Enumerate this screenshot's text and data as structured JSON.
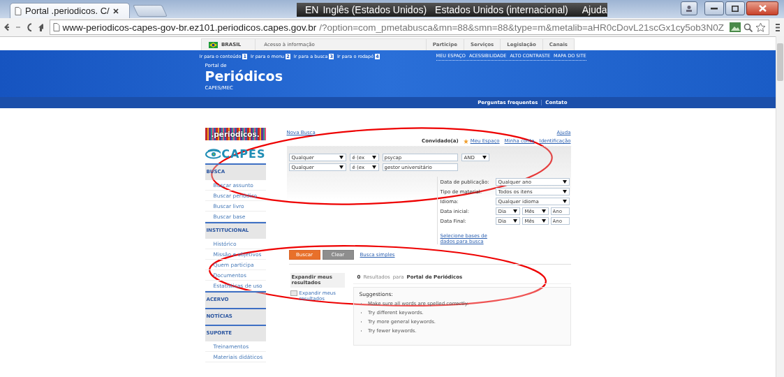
{
  "browser": {
    "tab_title": "Portal .periodicos. C/",
    "language_bar": {
      "code": "EN",
      "language": "Inglês (Estados Unidos)",
      "keyboard": "Estados Unidos (internacional)",
      "help": "Ajuda"
    },
    "url_host": "www-periodicos-capes-gov-br.ez101.periodicos.capes.gov.br",
    "url_path": "/?option=com_pmetabusca&mn=88&smn=88&type=m&metalib=aHR0cDovL21scGx1cy5ob3N0Z"
  },
  "gov_bar": {
    "country": "BRASIL",
    "access": "Acesso à informação",
    "links": [
      "Participe",
      "Serviços",
      "Legislação",
      "Canais"
    ]
  },
  "header": {
    "skip_links": [
      {
        "label": "Ir para o conteúdo",
        "key": "1"
      },
      {
        "label": "Ir para o menu",
        "key": "2"
      },
      {
        "label": "Ir para a busca",
        "key": "3"
      },
      {
        "label": "Ir para o rodapé",
        "key": "4"
      }
    ],
    "top_links": [
      "MEU ESPAÇO",
      "ACESSIBILIDADE",
      "ALTO CONTRASTE",
      "MAPA DO SITE"
    ],
    "pretitle": "Portal de",
    "title": "Periódicos",
    "subtitle": "CAPES/MEC",
    "nav_links": [
      "Perguntas frequentes",
      "Contato"
    ]
  },
  "sidebar": {
    "logo": ".periodicos.",
    "brand": "CAPES",
    "sections": [
      {
        "title": "BUSCA",
        "items": [
          "Buscar assunto",
          "Buscar periódico",
          "Buscar livro",
          "Buscar base"
        ]
      },
      {
        "title": "INSTITUCIONAL",
        "items": [
          "Histórico",
          "Missão e objetivos",
          "Quem participa",
          "Documentos",
          "Estatísticas de uso"
        ]
      },
      {
        "title": "ACERVO"
      },
      {
        "title": "NOTÍCIAS"
      },
      {
        "title": "SUPORTE",
        "items": [
          "Treinamentos",
          "Materiais didáticos"
        ]
      }
    ]
  },
  "search": {
    "new_search": "Nova Busca",
    "help": "Ajuda",
    "user": "Convidado(a)",
    "user_links": [
      {
        "label": "Meu Espaço",
        "kind": "starred"
      },
      {
        "label": "Minha conta",
        "kind": "link"
      },
      {
        "label": "Identificação",
        "kind": "link"
      }
    ],
    "rows": [
      {
        "field": "Qualquer",
        "operator": "é (ex",
        "value": "psycap",
        "boolean": "AND"
      },
      {
        "field": "Qualquer",
        "operator": "é (ex",
        "value": "gestor universitário"
      }
    ],
    "filters": [
      {
        "kind": "select",
        "label": "Data de publicação:",
        "value": "Qualquer ano"
      },
      {
        "kind": "select",
        "label": "Tipo de material:",
        "value": "Todos os itens"
      },
      {
        "kind": "select",
        "label": "Idioma:",
        "value": "Qualquer idioma"
      },
      {
        "kind": "date",
        "label": "Data inicial:",
        "day": "Dia",
        "month": "Mês",
        "year": {
          "placeholder": "Ano"
        }
      },
      {
        "kind": "date",
        "label": "Data Final:",
        "day": "Dia",
        "month": "Mês",
        "year": {
          "placeholder": "Ano"
        }
      }
    ],
    "databases_link": "Selecione bases de dados para busca",
    "buttons": [
      {
        "label": "Buscar",
        "kind": "primary"
      },
      {
        "label": "Clear",
        "kind": "secondary"
      }
    ],
    "simple_search": "Busca simples"
  },
  "results": {
    "facet_title": "Expandir meus resultados",
    "expand": {
      "label": "Expandir meus resultados",
      "checked": false
    },
    "count": "0",
    "count_label": "Resultados",
    "for_label": "para",
    "scope": "Portal de Periódicos",
    "suggestions_title": "Suggestions:",
    "suggestions": [
      "Make sure all words are spelled correctly.",
      "Try different keywords.",
      "Try more general keywords.",
      "Try fewer keywords."
    ]
  },
  "annotations": [
    {
      "kind": "ellipse"
    },
    {
      "kind": "ellipse"
    }
  ]
}
